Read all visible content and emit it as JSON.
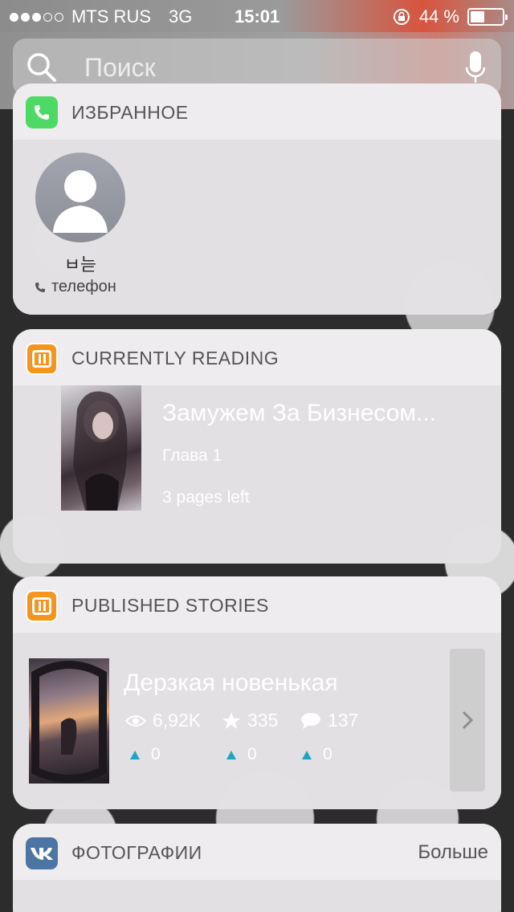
{
  "status_bar": {
    "carrier": "MTS RUS",
    "network": "3G",
    "time": "15:01",
    "battery": "44 %",
    "battery_level": 0.44,
    "signal_bars_filled": 3,
    "signal_bars_total": 5
  },
  "search": {
    "placeholder": "Поиск"
  },
  "favorites": {
    "title": "ИЗБРАННОЕ",
    "contact_name": "ㅂ늗",
    "contact_type": "телефон"
  },
  "currently_reading": {
    "title": "CURRENTLY READING",
    "book_title": "Замужем За Бизнесом...",
    "chapter": "Глава 1",
    "pages_left": "3 pages left"
  },
  "published_stories": {
    "title": "PUBLISHED STORIES",
    "story_title": "Дерзкая новенькая",
    "views": "6,92K",
    "votes": "335",
    "comments": "137",
    "views_delta": "0",
    "votes_delta": "0",
    "comments_delta": "0"
  },
  "photos": {
    "title": "ФОТОГРАФИИ",
    "more": "Больше"
  },
  "colors": {
    "wattpad_orange": "#f7941e",
    "vk_blue": "#4c75a3",
    "phone_green": "#4cd964",
    "delta_teal": "#1ba7c4"
  }
}
